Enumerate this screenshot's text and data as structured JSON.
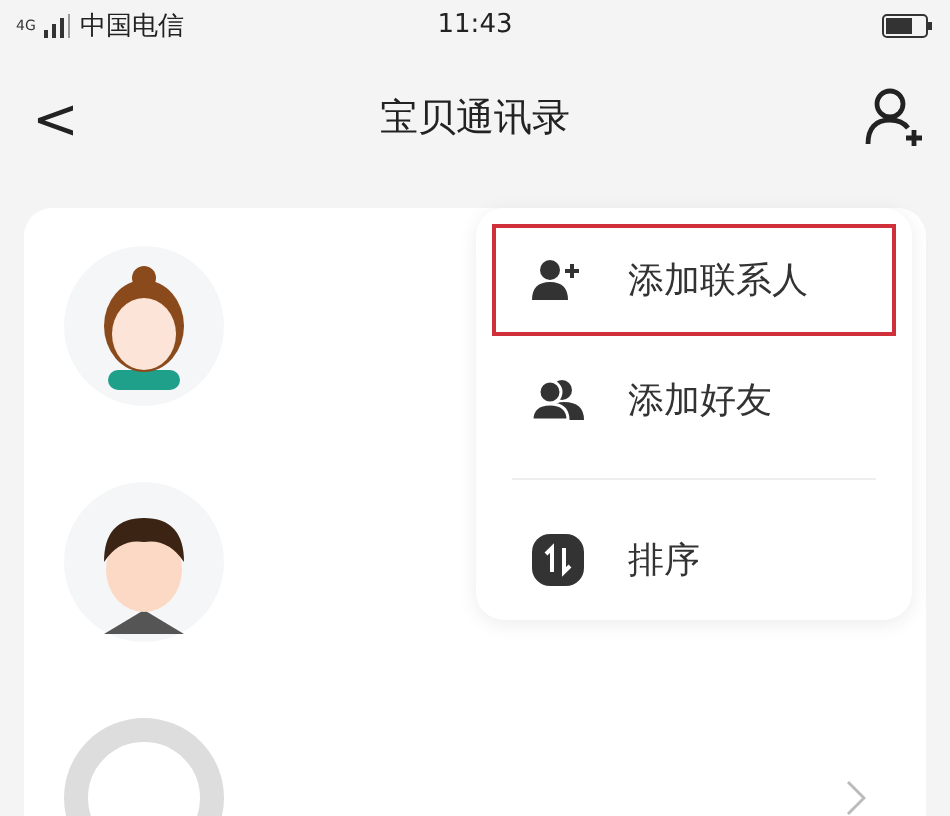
{
  "status_bar": {
    "network": "4G",
    "carrier": "中国电信",
    "time": "11:43"
  },
  "header": {
    "back": "<",
    "title": "宝贝通讯录"
  },
  "contacts": [
    {
      "kind": "girl"
    },
    {
      "kind": "boy"
    },
    {
      "kind": "placeholder",
      "chevron": true
    }
  ],
  "menu": {
    "items": [
      {
        "kind": "add-contact",
        "label": "添加联系人",
        "selected": true
      },
      {
        "kind": "add-friend",
        "label": "添加好友",
        "selected": false
      },
      {
        "kind": "sort",
        "label": "排序",
        "selected": false
      }
    ]
  }
}
